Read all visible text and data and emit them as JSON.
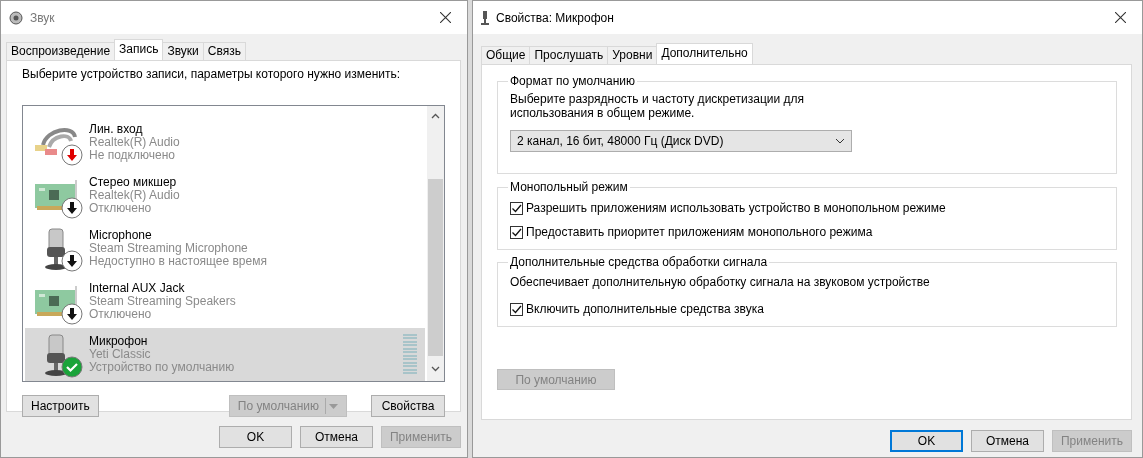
{
  "sound_window": {
    "title": "Звук",
    "tabs": [
      {
        "label": "Воспроизведение",
        "selected": false
      },
      {
        "label": "Запись",
        "selected": true
      },
      {
        "label": "Звуки",
        "selected": false
      },
      {
        "label": "Связь",
        "selected": false
      }
    ],
    "instruction": "Выберите устройство записи, параметры которого нужно изменить:",
    "devices": [
      {
        "kind": "line-in",
        "badge": {
          "kind": "unplugged"
        },
        "name": "Лин. вход",
        "driver": "Realtek(R) Audio",
        "state": "Не подключено",
        "selected": false
      },
      {
        "kind": "card",
        "badge": {
          "kind": "disabled"
        },
        "name": "Стерео микшер",
        "driver": "Realtek(R) Audio",
        "state": "Отключено",
        "selected": false
      },
      {
        "kind": "mic",
        "badge": {
          "kind": "disabled"
        },
        "name": "Microphone",
        "driver": "Steam Streaming Microphone",
        "state": "Недоступно в настоящее время",
        "selected": false
      },
      {
        "kind": "card",
        "badge": {
          "kind": "disabled"
        },
        "name": "Internal AUX Jack",
        "driver": "Steam Streaming Speakers",
        "state": "Отключено",
        "selected": false
      },
      {
        "kind": "mic",
        "badge": {
          "kind": "default"
        },
        "name": "Микрофон",
        "driver": "Yeti Classic",
        "state": "Устройство по умолчанию",
        "selected": true,
        "meter": true
      }
    ],
    "configure_button": "Настроить",
    "default_button": {
      "label": "По умолчанию",
      "disabled": true
    },
    "properties_button": "Свойства",
    "buttons": [
      {
        "label": "OK",
        "disabled": false
      },
      {
        "label": "Отмена",
        "disabled": false
      },
      {
        "label": "Применить",
        "disabled": true
      }
    ]
  },
  "properties_window": {
    "title": "Свойства: Микрофон",
    "tabs": [
      {
        "label": "Общие",
        "selected": false
      },
      {
        "label": "Прослушать",
        "selected": false
      },
      {
        "label": "Уровни",
        "selected": false
      },
      {
        "label": "Дополнительно",
        "selected": true
      }
    ],
    "default_format": {
      "legend": "Формат по умолчанию",
      "description": "Выберите разрядность и частоту дискретизации для использования в общем режиме.",
      "format": "2 канал, 16 бит, 48000 Гц (Диск DVD)"
    },
    "exclusive_mode": {
      "legend": "Монопольный режим",
      "options": [
        {
          "label": "Разрешить приложениям использовать устройство в монопольном режиме",
          "checked": true
        },
        {
          "label": "Предоставить приоритет приложениям монопольного режима",
          "checked": true
        }
      ]
    },
    "enhancements": {
      "legend": "Дополнительные средства обработки сигнала",
      "description": "Обеспечивает дополнительную обработку сигнала на звуковом устройстве",
      "options": [
        {
          "label": "Включить дополнительные средства звука",
          "checked": true
        }
      ]
    },
    "restore_button": {
      "label": "По умолчанию",
      "disabled": true
    },
    "buttons": [
      {
        "label": "OK",
        "disabled": false,
        "focused": true
      },
      {
        "label": "Отмена",
        "disabled": false,
        "focused": false
      },
      {
        "label": "Применить",
        "disabled": true,
        "focused": false
      }
    ]
  }
}
